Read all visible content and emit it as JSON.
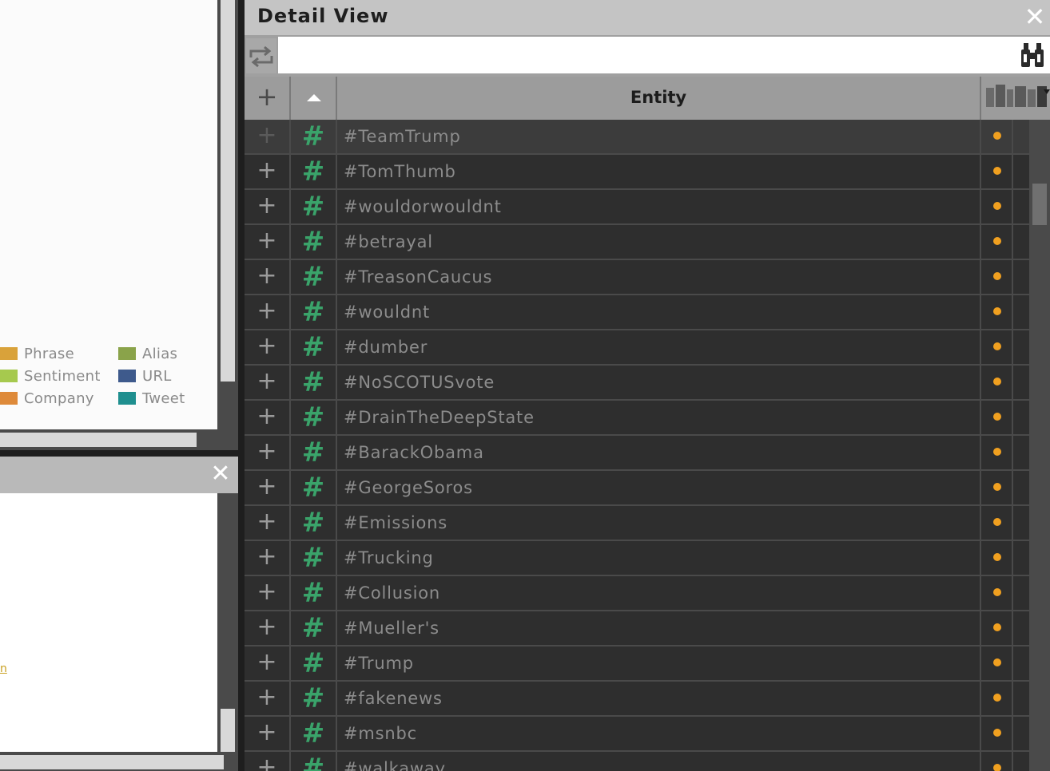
{
  "legend": {
    "items": [
      {
        "label": "Phrase",
        "color": "#d9a23a"
      },
      {
        "label": "Alias",
        "color": "#8aa34a"
      },
      {
        "label": "Sentiment",
        "color": "#a6c94e"
      },
      {
        "label": "URL",
        "color": "#3e5a8c"
      },
      {
        "label": "Company",
        "color": "#de8a3a"
      },
      {
        "label": "Tweet",
        "color": "#1f8f8f"
      }
    ]
  },
  "left_bottom": {
    "close_glyph": "✕",
    "link_fragment": "n"
  },
  "detail": {
    "title": "Detail View",
    "close_glyph": "✕",
    "search": {
      "value": "",
      "placeholder": ""
    },
    "header": {
      "add_glyph": "+",
      "entity_label": "Entity"
    },
    "row_add_glyph": "+",
    "type_glyph": "#",
    "type_color": "#3aa36a",
    "flag_color": "#f0a020",
    "rows": [
      "#TeamTrump",
      "#TomThumb",
      "#wouldorwouldnt",
      "#betrayal",
      "#TreasonCaucus",
      "#wouldnt",
      "#dumber",
      "#NoSCOTUSvote",
      "#DrainTheDeepState",
      "#BarackObama",
      "#GeorgeSoros",
      "#Emissions",
      "#Trucking",
      "#Collusion",
      "#Mueller's",
      "#Trump",
      "#fakenews",
      "#msnbc",
      "#walkaway"
    ]
  }
}
